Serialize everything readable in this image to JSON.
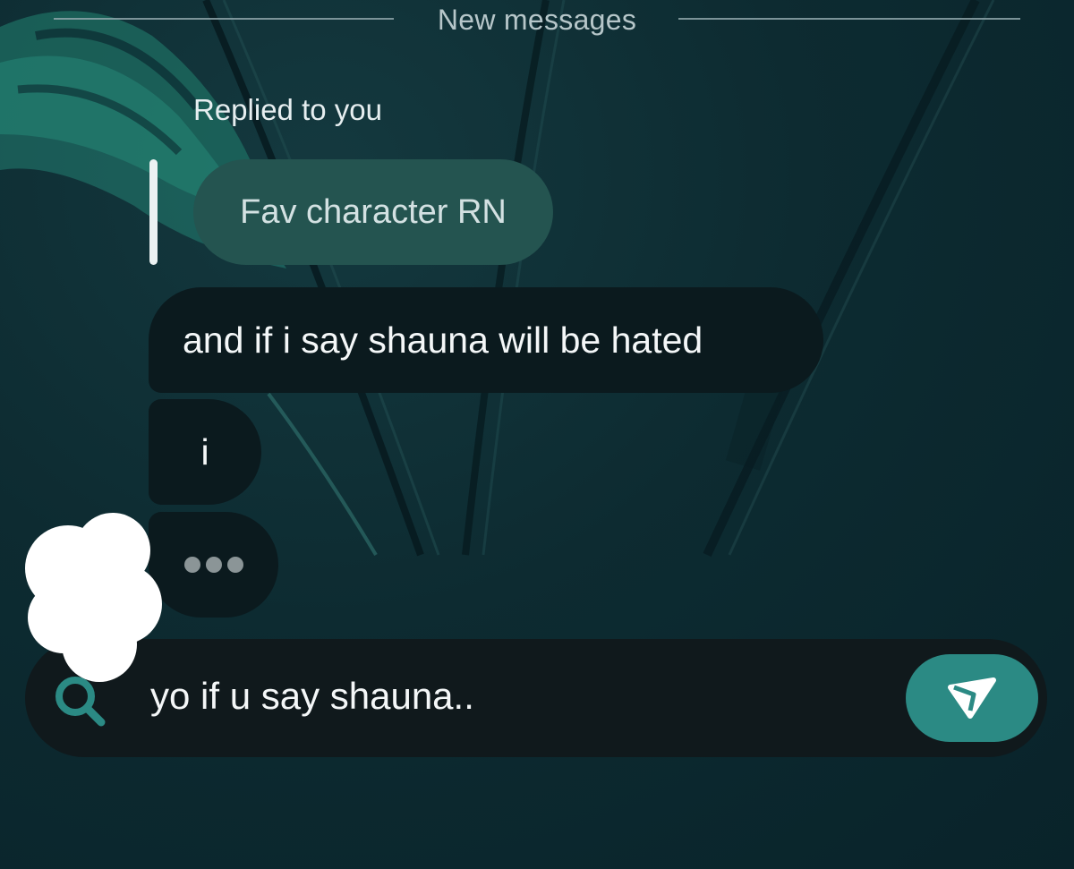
{
  "divider": {
    "label": "New messages"
  },
  "reply": {
    "caption": "Replied to you",
    "quoted_text": "Fav character RN"
  },
  "messages": [
    {
      "text": "and if i say shauna will be hated"
    },
    {
      "text": "i"
    }
  ],
  "typing_indicator": {
    "icon": "typing-dots"
  },
  "composer": {
    "text": "yo if u say shauna..",
    "search_icon": "search-icon",
    "send_icon": "send-icon"
  },
  "colors": {
    "accent": "#2b8a84",
    "quoted_bubble": "#245450",
    "message_bubble": "#0b1a1e",
    "background": "#0c2a30"
  }
}
